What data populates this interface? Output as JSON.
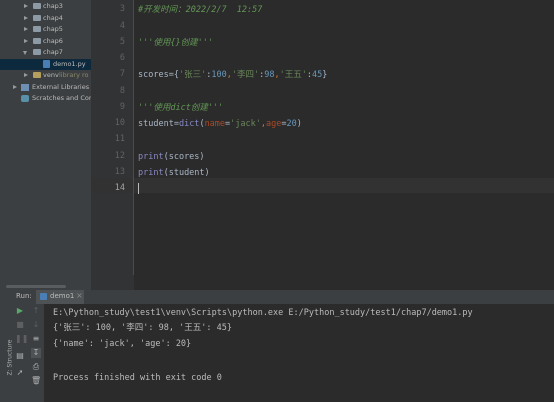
{
  "project_tree": {
    "items": [
      {
        "label": "chap3",
        "type": "folder",
        "expanded": false
      },
      {
        "label": "chap4",
        "type": "folder",
        "expanded": false
      },
      {
        "label": "chap5",
        "type": "folder",
        "expanded": false
      },
      {
        "label": "chap6",
        "type": "folder",
        "expanded": false
      },
      {
        "label": "chap7",
        "type": "folder",
        "expanded": true
      },
      {
        "label": "demo1.py",
        "type": "python-file",
        "selected": true
      },
      {
        "label": "venv",
        "extra": "library ro",
        "type": "folder",
        "expanded": false
      },
      {
        "label": "External Libraries",
        "type": "library",
        "expanded": false
      },
      {
        "label": "Scratches and Con",
        "type": "scratch"
      }
    ]
  },
  "editor": {
    "line_numbers": [
      "3",
      "4",
      "5",
      "6",
      "7",
      "8",
      "9",
      "10",
      "11",
      "12",
      "13",
      "14"
    ],
    "lines": {
      "l3": "#开发时间：2022/2/7  12:57",
      "l5": "'''使用{}创建'''",
      "l7": {
        "var": "scores",
        "eq": "=",
        "open": "{",
        "k1": "'张三'",
        "c1": ":",
        "v1": "100",
        "s1": ",",
        "k2": "'李四'",
        "c2": ":",
        "v2": "98",
        "s2": ",",
        "k3": "'王五'",
        "c3": ":",
        "v3": "45",
        "close": "}"
      },
      "l9": "'''使用dict创建'''",
      "l10": {
        "var": "student",
        "eq": "=",
        "fn": "dict",
        "open": "(",
        "p1": "name",
        "e1": "=",
        "s1": "'jack'",
        "comma": ",",
        "p2": "age",
        "e2": "=",
        "n2": "20",
        "close": ")"
      },
      "l12": {
        "fn": "print",
        "arg": "(scores)"
      },
      "l13": {
        "fn": "print",
        "arg": "(student)"
      }
    }
  },
  "run_panel": {
    "label": "Run:",
    "tab_label": "demo1",
    "close_glyph": "×",
    "side_label": "Z: Structure",
    "output": [
      "E:\\Python_study\\test1\\venv\\Scripts\\python.exe E:/Python_study/test1/chap7/demo1.py",
      "{'张三': 100, '李四': 98, '王五': 45}",
      "{'name': 'jack', 'age': 20}",
      "",
      "Process finished with exit code 0"
    ]
  },
  "colors": {
    "editor_bg": "#2b2b2b",
    "panel_bg": "#3c3f41",
    "string": "#6a8759",
    "number": "#6897bb",
    "keyword_param": "#aa4926",
    "builtin": "#8888c6",
    "comment": "#629755"
  },
  "icons": {
    "run": "play-icon",
    "stop": "stop-icon",
    "rerun": "rerun-icon",
    "scroll": "scroll-to-end-icon"
  }
}
